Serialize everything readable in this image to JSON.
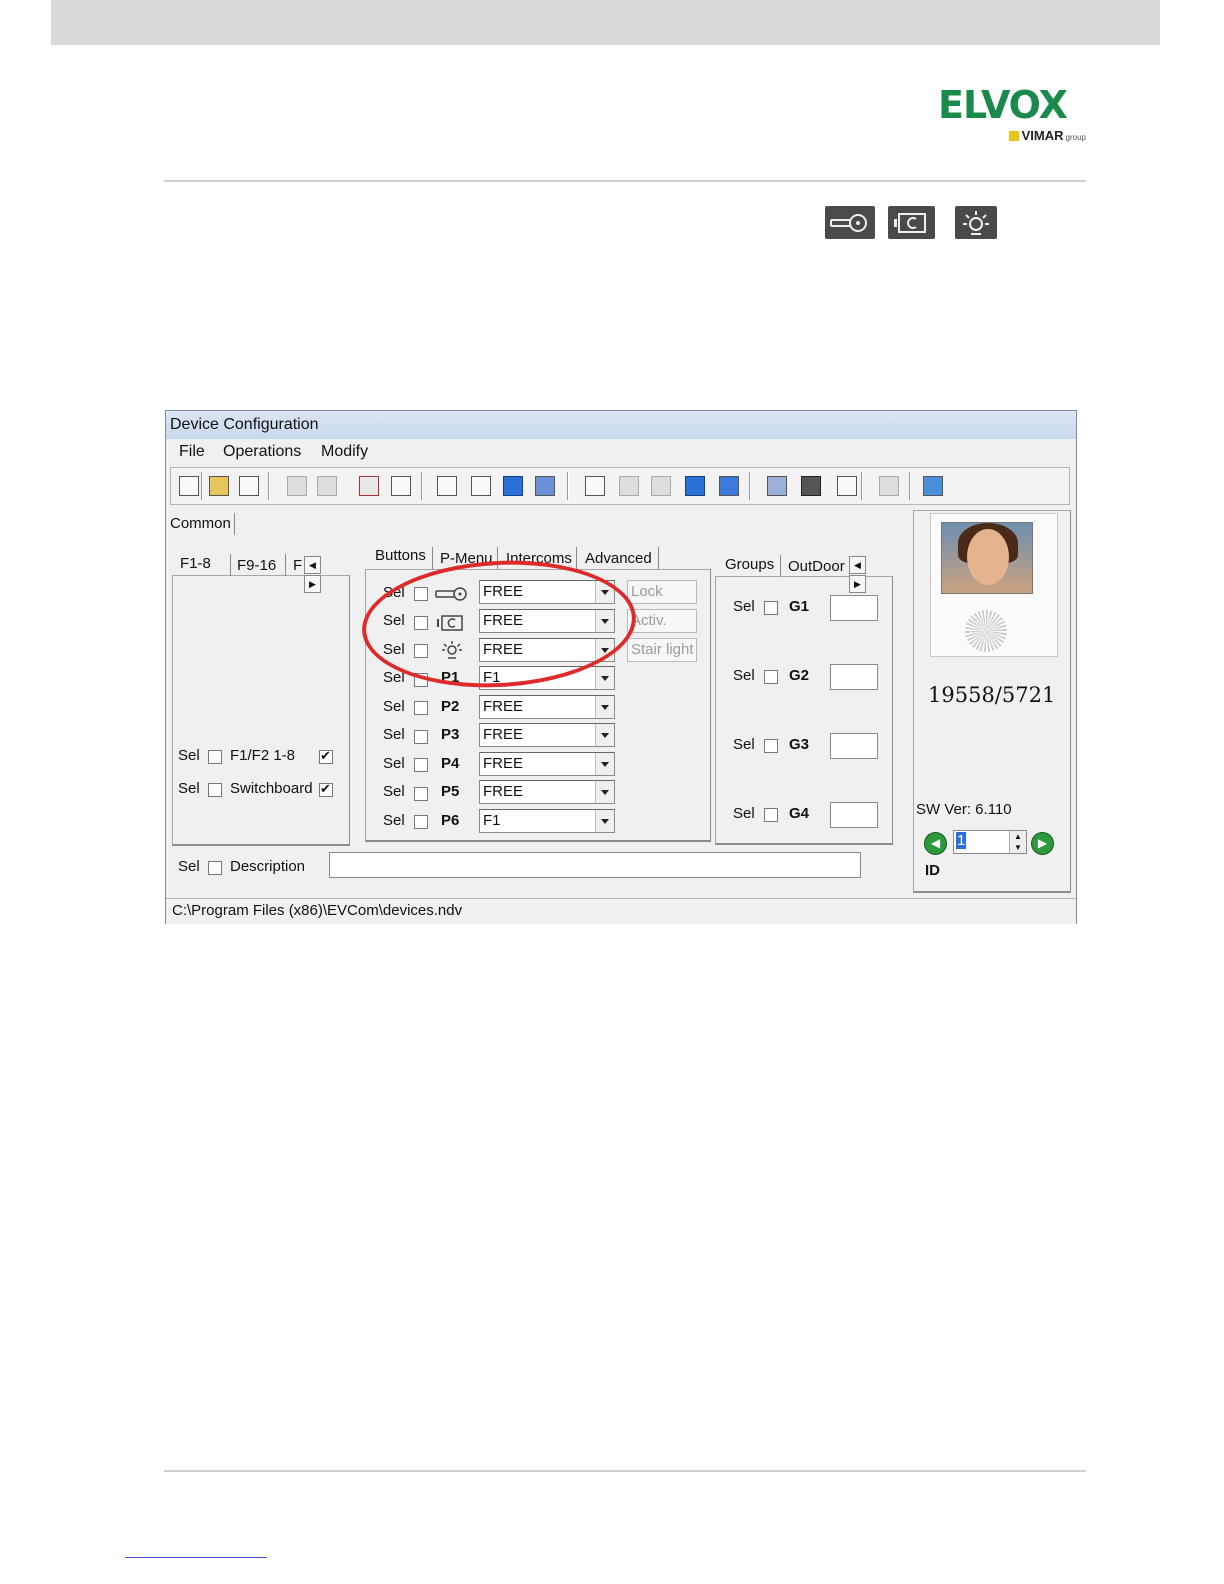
{
  "brand": {
    "logo_text": "ELVOX",
    "sub_text": "VIMAR",
    "sub_small": "group"
  },
  "header_icons": [
    "key-lock-icon",
    "door-activation-icon",
    "stair-light-icon"
  ],
  "window": {
    "title": "Device Configuration",
    "menu": [
      "File",
      "Operations",
      "Modify"
    ],
    "common_tab": "Common",
    "left_tabs": [
      "F1-8",
      "F9-16",
      "F"
    ],
    "left_rows": [
      {
        "sel": "Sel",
        "label": "F1/F2 1-8",
        "checked": true
      },
      {
        "sel": "Sel",
        "label": "Switchboard",
        "checked": true
      }
    ],
    "button_tabs": [
      "Buttons",
      "P-Menu",
      "Intercoms",
      "Advanced"
    ],
    "button_rows": [
      {
        "sel": "Sel",
        "key": "",
        "icon": "key-lock-icon",
        "value": "FREE",
        "extra": "Lock"
      },
      {
        "sel": "Sel",
        "key": "",
        "icon": "door-activation-icon",
        "value": "FREE",
        "extra": "Activ."
      },
      {
        "sel": "Sel",
        "key": "",
        "icon": "stair-light-icon",
        "value": "FREE",
        "extra": "Stair light"
      },
      {
        "sel": "Sel",
        "key": "P1",
        "icon": "",
        "value": "F1",
        "extra": ""
      },
      {
        "sel": "Sel",
        "key": "P2",
        "icon": "",
        "value": "FREE",
        "extra": ""
      },
      {
        "sel": "Sel",
        "key": "P3",
        "icon": "",
        "value": "FREE",
        "extra": ""
      },
      {
        "sel": "Sel",
        "key": "P4",
        "icon": "",
        "value": "FREE",
        "extra": ""
      },
      {
        "sel": "Sel",
        "key": "P5",
        "icon": "",
        "value": "FREE",
        "extra": ""
      },
      {
        "sel": "Sel",
        "key": "P6",
        "icon": "",
        "value": "F1",
        "extra": ""
      }
    ],
    "group_tabs": [
      "Groups",
      "OutDoor I"
    ],
    "group_rows": [
      {
        "sel": "Sel",
        "label": "G1"
      },
      {
        "sel": "Sel",
        "label": "G2"
      },
      {
        "sel": "Sel",
        "label": "G3"
      },
      {
        "sel": "Sel",
        "label": "G4"
      }
    ],
    "description": {
      "sel": "Sel",
      "label": "Description",
      "value": ""
    },
    "device": {
      "model": "19558/5721",
      "sw_version": "SW Ver: 6.110",
      "id_value": "1",
      "id_label": "ID"
    },
    "status_path": "C:\\Program Files (x86)\\EVCom\\devices.ndv"
  }
}
